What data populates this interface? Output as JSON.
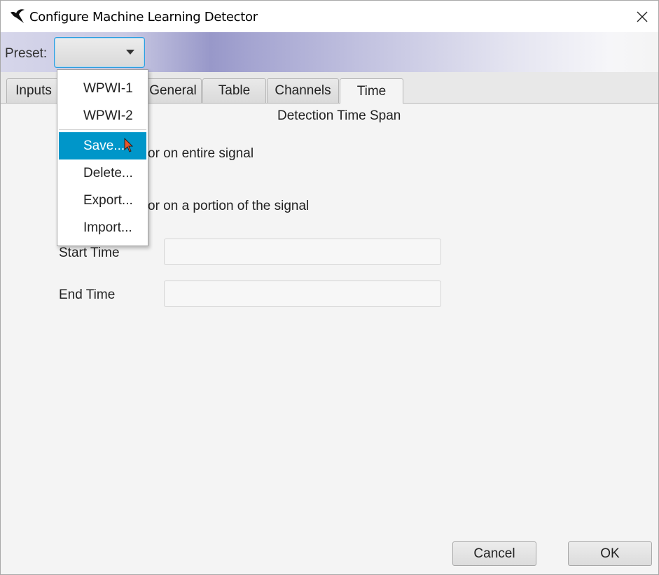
{
  "window": {
    "title": "Configure Machine Learning Detector"
  },
  "preset": {
    "label": "Preset:",
    "value": ""
  },
  "tabs": [
    {
      "label": "Inputs"
    },
    {
      "label": "General"
    },
    {
      "label": "Table"
    },
    {
      "label": "Channels"
    },
    {
      "label": "Time",
      "active": true
    }
  ],
  "time_panel": {
    "section_title": "Detection Time Span",
    "option_entire": "Run detector on entire signal",
    "option_entire_visible": "or on entire signal",
    "option_portion": "Run detector on a portion of the signal",
    "option_portion_visible": "or on a portion of the signal",
    "start_time_label": "Start Time",
    "start_time_value": "",
    "end_time_label": "End Time",
    "end_time_value": ""
  },
  "preset_menu": {
    "items": [
      {
        "label": "WPWI-1"
      },
      {
        "label": "WPWI-2"
      },
      {
        "label": "Save...",
        "selected": true
      },
      {
        "label": "Delete..."
      },
      {
        "label": "Export..."
      },
      {
        "label": "Import..."
      }
    ]
  },
  "buttons": {
    "cancel": "Cancel",
    "ok": "OK"
  },
  "colors": {
    "selection": "#0096c9",
    "focus_border": "#2a9ee0"
  },
  "icons": {
    "app": "bird-icon",
    "close": "close-icon",
    "dropdown": "chevron-down-icon",
    "cursor": "mouse-pointer-icon"
  }
}
